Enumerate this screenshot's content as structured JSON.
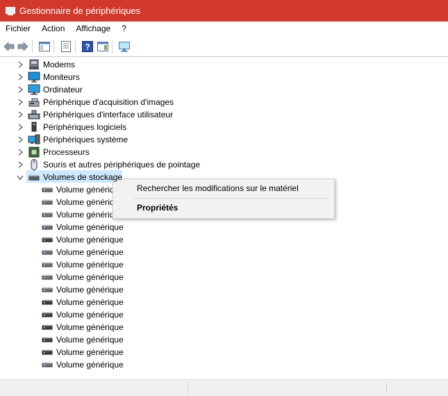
{
  "window": {
    "title": "Gestionnaire de périphériques"
  },
  "menu": [
    "Fichier",
    "Action",
    "Affichage",
    "?"
  ],
  "toolbar": [
    "back-icon",
    "forward-icon",
    "show-hide-console-tree-icon",
    "properties-icon",
    "help-icon",
    "action-pane-icon",
    "scan-hardware-icon"
  ],
  "tree": {
    "categories": [
      {
        "label": "Modems",
        "icon": "modem-icon"
      },
      {
        "label": "Moniteurs",
        "icon": "monitor-icon"
      },
      {
        "label": "Ordinateur",
        "icon": "computer-icon"
      },
      {
        "label": "Périphérique d'acquisition d'images",
        "icon": "imaging-device-icon"
      },
      {
        "label": "Périphériques d'interface utilisateur",
        "icon": "hid-icon"
      },
      {
        "label": "Périphériques logiciels",
        "icon": "software-device-icon"
      },
      {
        "label": "Périphériques système",
        "icon": "system-device-icon"
      },
      {
        "label": "Processeurs",
        "icon": "processor-icon"
      },
      {
        "label": "Souris et autres périphériques de pointage",
        "icon": "mouse-icon"
      },
      {
        "label": "Volumes de stockage",
        "icon": "storage-volume-icon",
        "expanded": true,
        "selected": true
      }
    ],
    "children": [
      "Volume générique",
      "Volume générique",
      "Volume générique",
      "Volume générique",
      "Volume générique",
      "Volume générique",
      "Volume générique",
      "Volume générique",
      "Volume générique",
      "Volume générique",
      "Volume générique",
      "Volume générique",
      "Volume générique",
      "Volume générique",
      "Volume générique"
    ]
  },
  "context_menu": {
    "scan": "Rechercher les modifications sur le matériel",
    "properties": "Propriétés"
  }
}
